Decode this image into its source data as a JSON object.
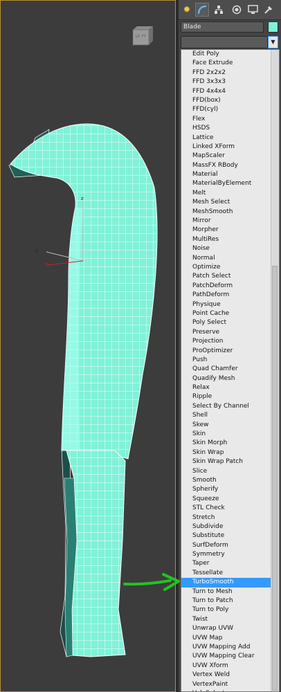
{
  "viewport": {
    "gizmo_axes": {
      "z": "z",
      "y": "y",
      "x": "x"
    },
    "viewcube_labels": {
      "left": "LE",
      "front": "FT"
    }
  },
  "panel": {
    "tabs": [
      {
        "name": "create-tab",
        "icon": "sun-icon"
      },
      {
        "name": "modify-tab",
        "icon": "modify-arc-icon"
      },
      {
        "name": "hierarchy-tab",
        "icon": "hierarchy-icon"
      },
      {
        "name": "motion-tab",
        "icon": "motion-icon"
      },
      {
        "name": "display-tab",
        "icon": "display-icon"
      },
      {
        "name": "utilities-tab",
        "icon": "hammer-icon"
      }
    ],
    "object_name": "Blade",
    "object_color": "#7ff2d8",
    "modifier_dropdown_value": "",
    "selected_modifier": "TurboSmooth",
    "selection_color": "#3399ff",
    "arrow_color": "#22c322",
    "modifiers": [
      "Edit Poly",
      "Face Extrude",
      "FFD 2x2x2",
      "FFD 3x3x3",
      "FFD 4x4x4",
      "FFD(box)",
      "FFD(cyl)",
      "Flex",
      "HSDS",
      "Lattice",
      "Linked XForm",
      "MapScaler",
      "MassFX RBody",
      "Material",
      "MaterialByElement",
      "Melt",
      "Mesh Select",
      "MeshSmooth",
      "Mirror",
      "Morpher",
      "MultiRes",
      "Noise",
      "Normal",
      "Optimize",
      "Patch Select",
      "PatchDeform",
      "PathDeform",
      "Physique",
      "Point Cache",
      "Poly Select",
      "Preserve",
      "Projection",
      "ProOptimizer",
      "Push",
      "Quad Chamfer",
      "Quadify Mesh",
      "Relax",
      "Ripple",
      "Select By Channel",
      "Shell",
      "Skew",
      "Skin",
      "Skin Morph",
      "Skin Wrap",
      "Skin Wrap Patch",
      "Slice",
      "Smooth",
      "Spherify",
      "Squeeze",
      "STL Check",
      "Stretch",
      "Subdivide",
      "Substitute",
      "SurfDeform",
      "Symmetry",
      "Taper",
      "Tessellate",
      "TurboSmooth",
      "Turn to Mesh",
      "Turn to Patch",
      "Turn to Poly",
      "Twist",
      "Unwrap UVW",
      "UVW Map",
      "UVW Mapping Add",
      "UVW Mapping Clear",
      "UVW Xform",
      "Vertex Weld",
      "VertexPaint",
      "Vol. Select"
    ]
  }
}
